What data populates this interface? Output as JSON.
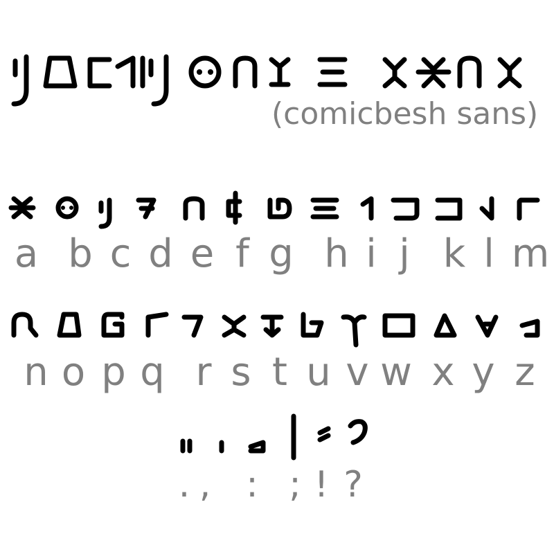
{
  "title": {
    "subtitle": "(comicbesh sans)"
  },
  "alphabet": {
    "row1": [
      "a",
      "b",
      "c",
      "d",
      "e",
      "f",
      "g",
      "h",
      "i",
      "j",
      "k",
      "l",
      "m"
    ],
    "row2": [
      "n",
      "o",
      "p",
      "q",
      "r",
      "s",
      "t",
      "u",
      "v",
      "w",
      "x",
      "y",
      "z"
    ]
  },
  "punctuation": [
    ".",
    ",",
    ":",
    ";",
    "!",
    "?"
  ]
}
